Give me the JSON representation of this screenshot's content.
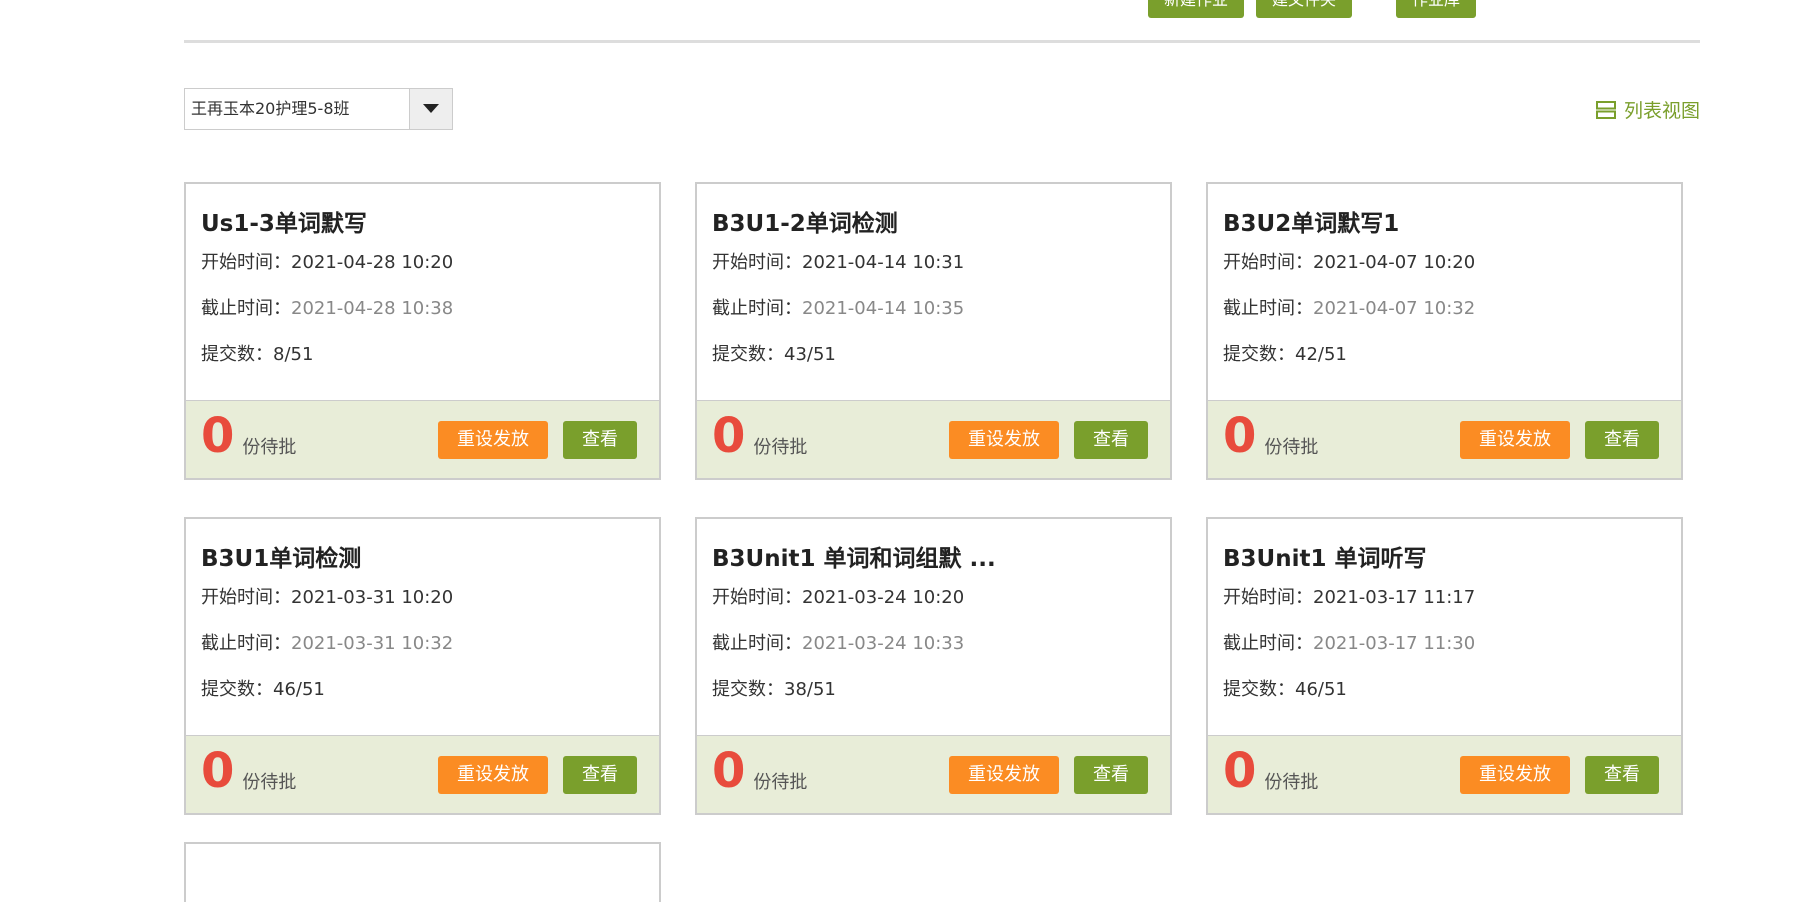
{
  "toolbar": {
    "new_homework": "新建作业",
    "new_folder": "建文件夹",
    "homework_library": "作业库"
  },
  "class_select": {
    "selected": "王再玉本20护理5-8班"
  },
  "view_toggle": {
    "label": "列表视图"
  },
  "labels": {
    "start_time": "开始时间：",
    "end_time": "截止时间：",
    "submissions": "提交数：",
    "pending": "份待批",
    "reset_button": "重设发放",
    "view_button": "查看"
  },
  "colors": {
    "accent_green": "#7a9f2c",
    "accent_orange": "#fb8c23",
    "pending_red": "#e84b3c",
    "footer_bg": "#e8edd8"
  },
  "assignments": [
    {
      "title": "Us1-3单词默写",
      "start": "2021-04-28 10:20",
      "end": "2021-04-28 10:38",
      "submissions": "8/51",
      "pending": "0"
    },
    {
      "title": "B3U1-2单词检测",
      "start": "2021-04-14 10:31",
      "end": "2021-04-14 10:35",
      "submissions": "43/51",
      "pending": "0"
    },
    {
      "title": "B3U2单词默写1",
      "start": "2021-04-07 10:20",
      "end": "2021-04-07 10:32",
      "submissions": "42/51",
      "pending": "0"
    },
    {
      "title": "B3U1单词检测",
      "start": "2021-03-31 10:20",
      "end": "2021-03-31 10:32",
      "submissions": "46/51",
      "pending": "0"
    },
    {
      "title": "B3Unit1 单词和词组默 ...",
      "start": "2021-03-24 10:20",
      "end": "2021-03-24 10:33",
      "submissions": "38/51",
      "pending": "0"
    },
    {
      "title": "B3Unit1 单词听写",
      "start": "2021-03-17 11:17",
      "end": "2021-03-17 11:30",
      "submissions": "46/51",
      "pending": "0"
    }
  ]
}
